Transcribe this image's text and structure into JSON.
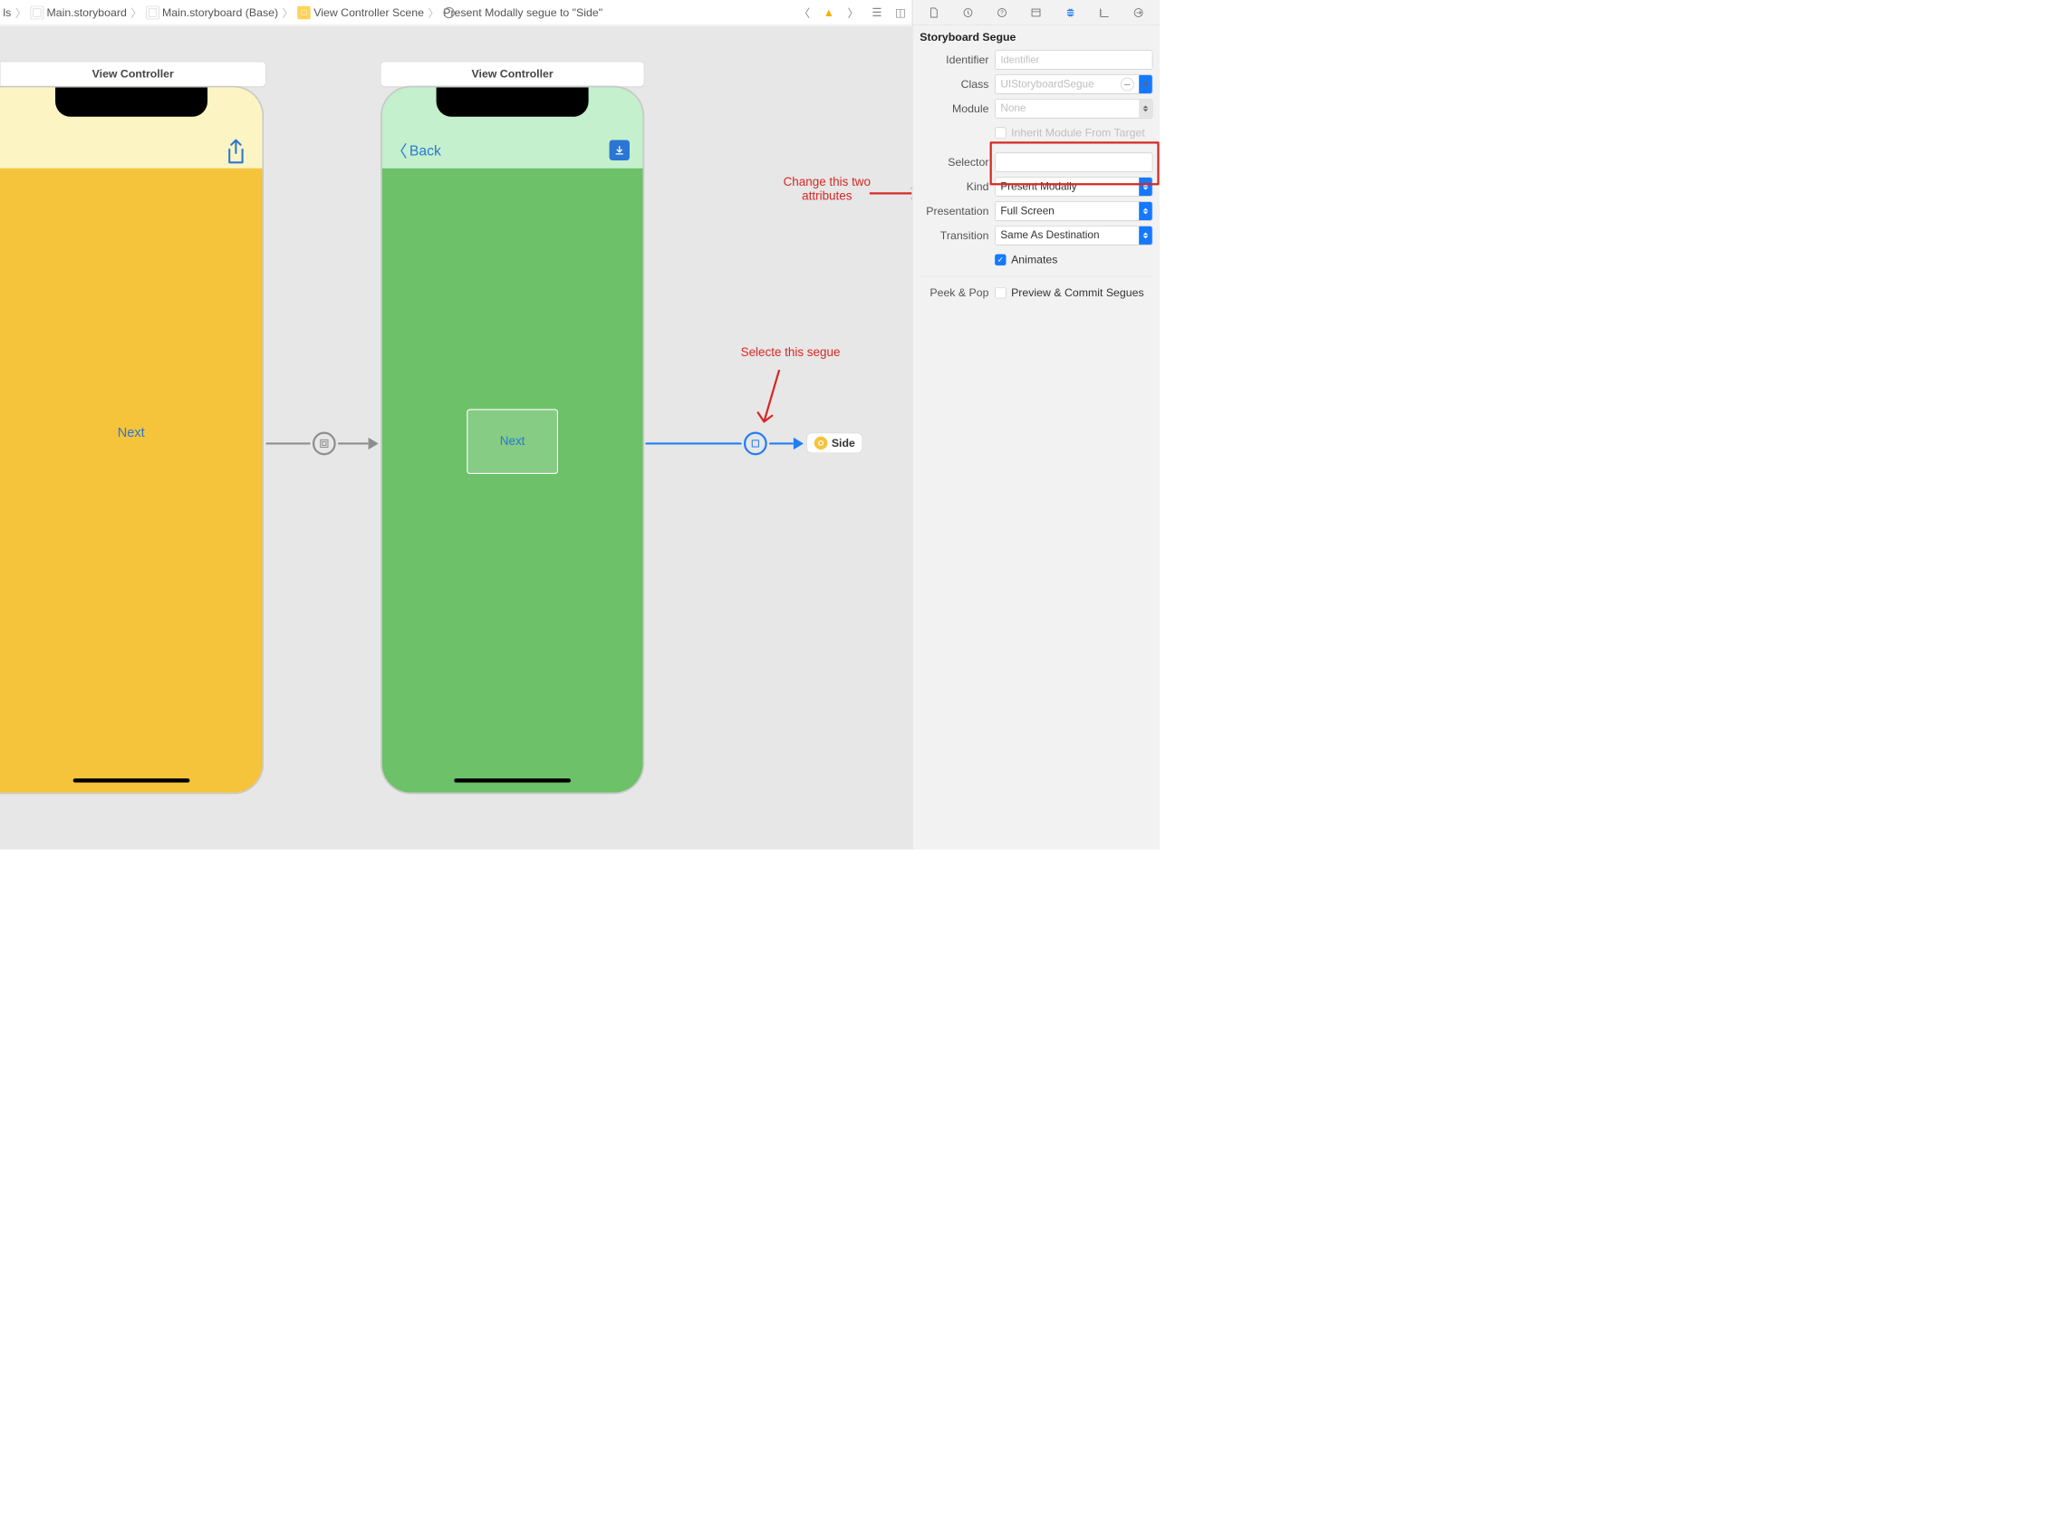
{
  "pathbar": {
    "crumbs": [
      "ls",
      "Main.storyboard",
      "Main.storyboard (Base)",
      "View Controller Scene",
      "Present Modally segue to \"Side\""
    ]
  },
  "canvas": {
    "vc1_title": "View Controller",
    "vc2_title": "View Controller",
    "phone1": {
      "next_label": "Next"
    },
    "phone2": {
      "back_label": "Back",
      "next_label": "Next"
    },
    "side_chip": "Side"
  },
  "annotations": {
    "select_segue": "Selecte this segue",
    "change_attrs_l1": "Change this two",
    "change_attrs_l2": "attributes"
  },
  "inspector": {
    "section_title": "Storyboard Segue",
    "identifier": {
      "label": "Identifier",
      "placeholder": "Identifier",
      "value": ""
    },
    "klass": {
      "label": "Class",
      "value": "UIStoryboardSegue"
    },
    "module": {
      "label": "Module",
      "value": "None"
    },
    "inherit_label": "Inherit Module From Target",
    "inherit_checked": false,
    "selector": {
      "label": "Selector",
      "value": ""
    },
    "kind": {
      "label": "Kind",
      "value": "Present Modally"
    },
    "presentation": {
      "label": "Presentation",
      "value": "Full Screen"
    },
    "transition": {
      "label": "Transition",
      "value": "Same As Destination"
    },
    "animates": {
      "label": "Animates",
      "checked": true
    },
    "peekpop": {
      "label": "Peek & Pop",
      "option": "Preview & Commit Segues",
      "checked": false
    }
  }
}
